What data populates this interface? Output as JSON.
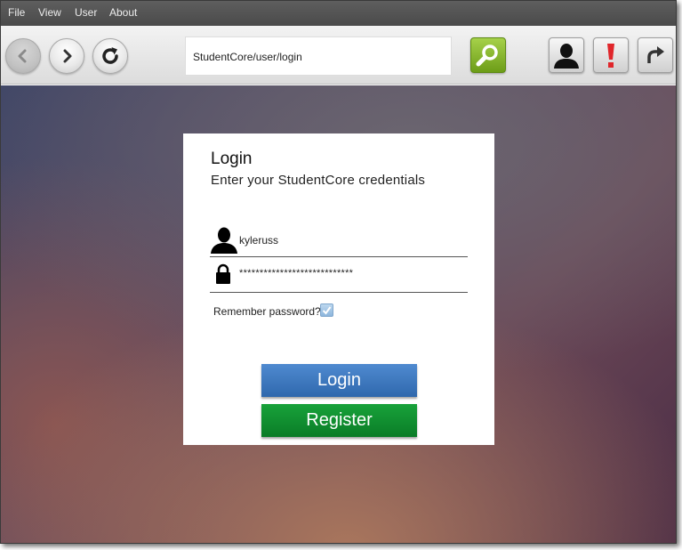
{
  "menu": {
    "items": [
      {
        "label": "File"
      },
      {
        "label": "View"
      },
      {
        "label": "User"
      },
      {
        "label": "About"
      }
    ]
  },
  "toolbar": {
    "address": "StudentCore/user/login",
    "icons": {
      "back": "chevron-left-icon",
      "forward": "chevron-right-icon",
      "reload": "refresh-icon",
      "search": "search-icon",
      "user": "user-icon",
      "alert": "alert-icon",
      "share": "share-arrow-icon"
    },
    "colors": {
      "search_button": "#7fb324",
      "alert": "#e0262b"
    }
  },
  "login": {
    "title": "Login",
    "subtitle": "Enter your StudentCore credentials",
    "username": "kyleruss",
    "password": "****************************",
    "remember_label": "Remember password?",
    "remember_checked": true,
    "login_button": "Login",
    "register_button": "Register",
    "colors": {
      "login_button": "#3b78c2",
      "register_button": "#0e8d2f"
    }
  }
}
